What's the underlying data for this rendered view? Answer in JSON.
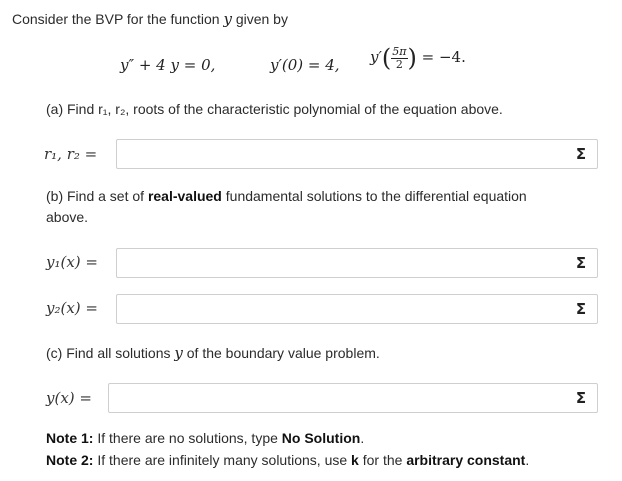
{
  "intro": {
    "text_before": "Consider the BVP for the function",
    "var": "y",
    "text_after": "given by"
  },
  "equation": {
    "ode": "y″ + 4 y = 0,",
    "bc1": "y′(0) = 4,",
    "bc2_lhs": "y′",
    "bc2_num": "5π",
    "bc2_den": "2",
    "bc2_rhs": "= −4."
  },
  "part_a": {
    "text": "(a) Find r₁, r₂, roots of the characteristic polynomial of the equation above.",
    "label": "r₁, r₂ =",
    "value": ""
  },
  "part_b": {
    "line1_before": "(b) Find a set of",
    "line1_bold": "real-valued",
    "line1_after": "fundamental solutions to the differential equation",
    "line2": "above.",
    "y1_label": "y₁(x) =",
    "y2_label": "y₂(x) =",
    "y1_value": "",
    "y2_value": ""
  },
  "part_c": {
    "text_before": "(c) Find all solutions",
    "var": "y",
    "text_after": "of the boundary value problem.",
    "label": "y(x) =",
    "value": ""
  },
  "notes": {
    "n1_label": "Note 1:",
    "n1_text": "If there are no solutions, type",
    "n1_bold": "No Solution",
    "n1_end": ".",
    "n2_label": "Note 2:",
    "n2_text": "If there are infinitely many solutions, use",
    "n2_bold_k": "k",
    "n2_mid": "for the",
    "n2_bold": "arbitrary constant",
    "n2_end": "."
  },
  "icons": {
    "equation_editor": "sigma-icon",
    "sigma_glyph": "Σ"
  }
}
